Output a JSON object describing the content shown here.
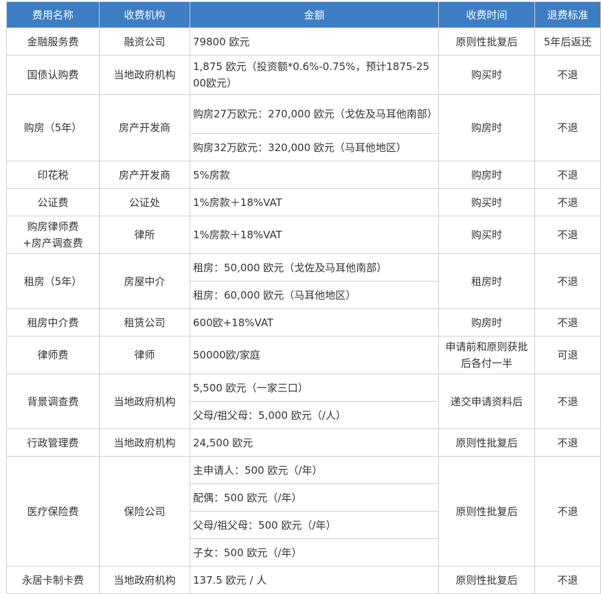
{
  "header": [
    "费用名称",
    "收费机构",
    "金额",
    "收费时间",
    "退费标准"
  ],
  "rows": [
    {
      "name": "金融服务费",
      "org": "融资公司",
      "amount": "79800 欧元",
      "time": "原则性批复后",
      "refund": "5年后返还"
    },
    {
      "name": "国债认购费",
      "org": "当地政府机构",
      "amount": "1,875 欧元（投资额*0.6%-0.75%，预计1875-2500欧元）",
      "time": "购买时",
      "refund": "不退"
    },
    {
      "name": "购房（5年）",
      "org": "房产开发商",
      "amounts": [
        "购房27万欧元：270,000 欧元（戈佐及马耳他南部）",
        "购房32万欧元：320,000 欧元（马耳他地区）"
      ],
      "time": "购房时",
      "refund": "不退"
    },
    {
      "name": "印花税",
      "org": "房产开发商",
      "amount": "5%房款",
      "time": "购房时",
      "refund": "不退"
    },
    {
      "name": "公证费",
      "org": "公证处",
      "amount": "1%房款＋18%VAT",
      "time": "购买时",
      "refund": "不退"
    },
    {
      "name_lines": [
        "购房律师费",
        "+房产调查费"
      ],
      "org": "律所",
      "amount": "1%房款＋18%VAT",
      "time": "购买时",
      "refund": "不退"
    },
    {
      "name": "租房（5年）",
      "org": "房屋中介",
      "amounts": [
        "租房：50,000 欧元（戈佐及马耳他南部）",
        "租房：60,000 欧元（马耳他地区）"
      ],
      "time": "租房时",
      "refund": "不退"
    },
    {
      "name": "租房中介费",
      "org": "租赁公司",
      "amount": "600欧+18%VAT",
      "time": "购房时",
      "refund": "不退"
    },
    {
      "name": "律师费",
      "org": "律师",
      "amount": "50000欧/家庭",
      "time": "申请前和原则获批后各付一半",
      "refund": "可退"
    },
    {
      "name": "背景调查费",
      "org": "当地政府机构",
      "amounts": [
        "5,500 欧元（一家三口）",
        "父母/祖父母：5,000 欧元（/人）"
      ],
      "time": "递交申请资料后",
      "refund": "不退"
    },
    {
      "name": "行政管理费",
      "org": "当地政府机构",
      "amount": "24,500 欧元",
      "time": "原则性批复后",
      "refund": "不退"
    },
    {
      "name": "医疗保险费",
      "org": "保险公司",
      "amounts": [
        "主申请人：500 欧元（/年）",
        "配偶：500 欧元（/年）",
        "父母/祖父母：500 欧元（/年）",
        "子女：500 欧元（/年）"
      ],
      "time": "原则性批复后",
      "refund": "不退"
    },
    {
      "name": "永居卡制卡费",
      "org": "当地政府机构",
      "amount": "137.5 欧元 / 人",
      "time": "原则性批复后",
      "refund": "不退"
    }
  ],
  "colors": {
    "header_bg": "#3d7dc3",
    "header_text": "#ffffff",
    "border": "#cfcfcf",
    "text": "#333333"
  }
}
